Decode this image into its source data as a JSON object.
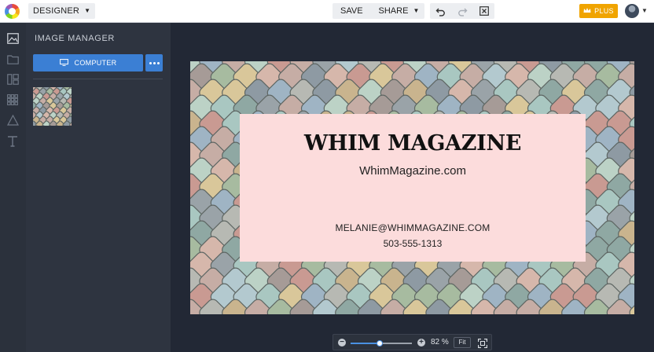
{
  "topbar": {
    "mode_label": "DESIGNER",
    "save_label": "SAVE",
    "share_label": "SHARE",
    "plus_label": "PLUS"
  },
  "rail": {
    "icons": [
      "image-icon",
      "folder-icon",
      "layout-icon",
      "grid-icon",
      "shapes-icon",
      "text-icon"
    ]
  },
  "panel": {
    "title": "IMAGE MANAGER",
    "computer_button": "COMPUTER"
  },
  "card": {
    "title": "WHIM MAGAZINE",
    "website": "WhimMagazine.com",
    "email": "MELANIE@WHIMMAGAZINE.COM",
    "phone": "503-555-1313"
  },
  "zoom": {
    "percent_label": "82 %",
    "fit_label": "Fit",
    "level": 0.82
  },
  "colors": {
    "accent_blue": "#3b7fd4",
    "plus_orange": "#f0a400",
    "card_pink": "#fcdcdc",
    "panel_dark": "#2e3440"
  }
}
